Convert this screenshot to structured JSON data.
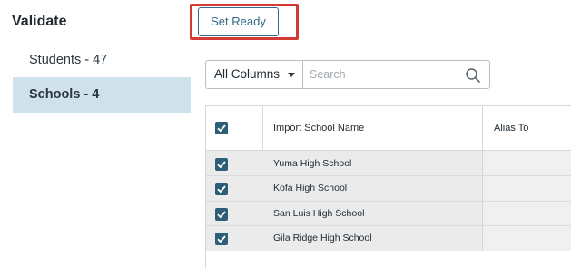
{
  "sidebar": {
    "title": "Validate",
    "items": [
      {
        "label": "Students - 47",
        "active": false
      },
      {
        "label": "Schools - 4",
        "active": true
      }
    ]
  },
  "toolbar": {
    "set_ready_label": "Set Ready",
    "highlight_color": "#d33a35"
  },
  "filter": {
    "column_select_value": "All Columns",
    "search_placeholder": "Search",
    "search_value": ""
  },
  "table": {
    "columns": [
      "Import School Name",
      "Alias To"
    ],
    "header_checked": true,
    "rows": [
      {
        "name": "Yuma High School",
        "checked": true
      },
      {
        "name": "Kofa High School",
        "checked": true
      },
      {
        "name": "San Luis High School",
        "checked": true
      },
      {
        "name": "Gila Ridge High School",
        "checked": true
      }
    ]
  },
  "colors": {
    "accent": "#2c5e78",
    "active_nav_bg": "#cfe1ea",
    "row_bg": "#ebebeb"
  }
}
